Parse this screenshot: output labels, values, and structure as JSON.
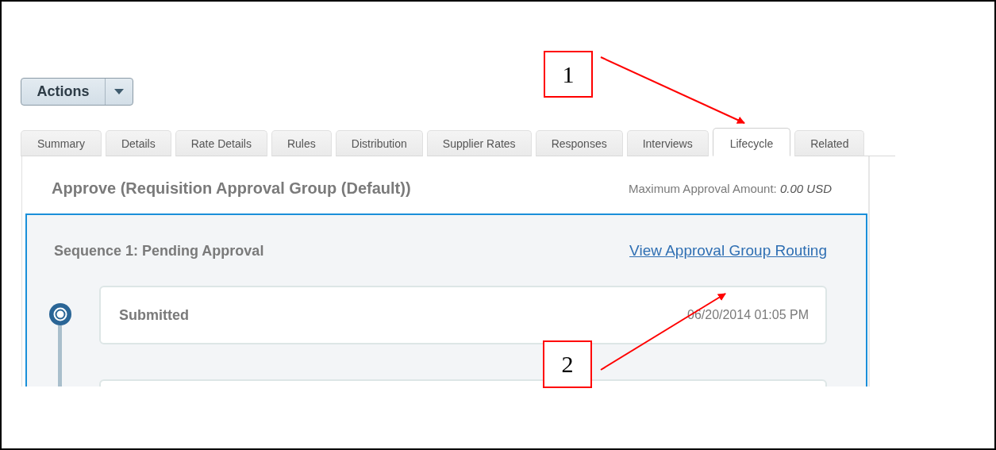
{
  "actions_button": {
    "label": "Actions"
  },
  "tabs": [
    {
      "label": "Summary",
      "selected": false
    },
    {
      "label": "Details",
      "selected": false
    },
    {
      "label": "Rate Details",
      "selected": false
    },
    {
      "label": "Rules",
      "selected": false
    },
    {
      "label": "Distribution",
      "selected": false
    },
    {
      "label": "Supplier Rates",
      "selected": false
    },
    {
      "label": "Responses",
      "selected": false
    },
    {
      "label": "Interviews",
      "selected": false
    },
    {
      "label": "Lifecycle",
      "selected": true
    },
    {
      "label": "Related",
      "selected": false
    }
  ],
  "panel": {
    "title": "Approve (Requisition Approval Group (Default))",
    "max_amount_label": "Maximum Approval Amount:",
    "max_amount_value": "0.00 USD",
    "sequence": {
      "title": "Sequence 1: Pending Approval",
      "link": "View Approval Group Routing",
      "steps": [
        {
          "label": "Submitted",
          "time": "06/20/2014 01:05 PM"
        }
      ]
    }
  },
  "annotations": [
    {
      "label": "1"
    },
    {
      "label": "2"
    }
  ]
}
